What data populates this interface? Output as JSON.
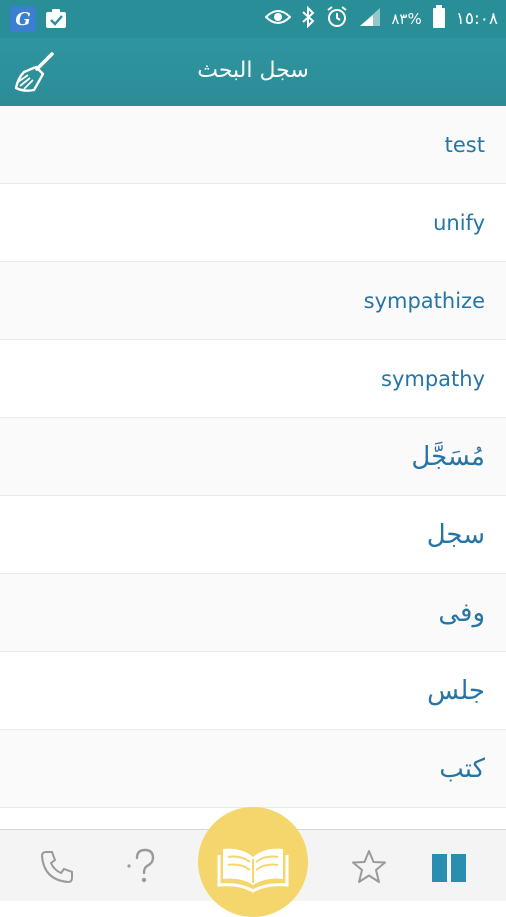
{
  "status_bar": {
    "time": "١٥:٠٨",
    "battery_percent": "٨٣%",
    "icons": [
      "app-g-icon",
      "clipboard-check-icon",
      "eye-icon",
      "bluetooth-icon",
      "alarm-icon",
      "signal-icon",
      "battery-icon"
    ]
  },
  "app_bar": {
    "title": "سجل البحث",
    "clear_icon": "broom-icon"
  },
  "history": [
    {
      "text": "test"
    },
    {
      "text": "unify"
    },
    {
      "text": "sympathize"
    },
    {
      "text": "sympathy"
    },
    {
      "text": "مُسَجَّل"
    },
    {
      "text": "سجل"
    },
    {
      "text": "وفى"
    },
    {
      "text": "جلس"
    },
    {
      "text": "كتب"
    }
  ],
  "bottom_nav": {
    "items": [
      "phone-icon",
      "question-icon",
      "open-book-icon",
      "star-icon",
      "book-icon"
    ],
    "accent_color": "#f5d66c",
    "active_color": "#2a8eb0"
  },
  "colors": {
    "primary": "#2a8e98",
    "item_text": "#2675a6"
  }
}
